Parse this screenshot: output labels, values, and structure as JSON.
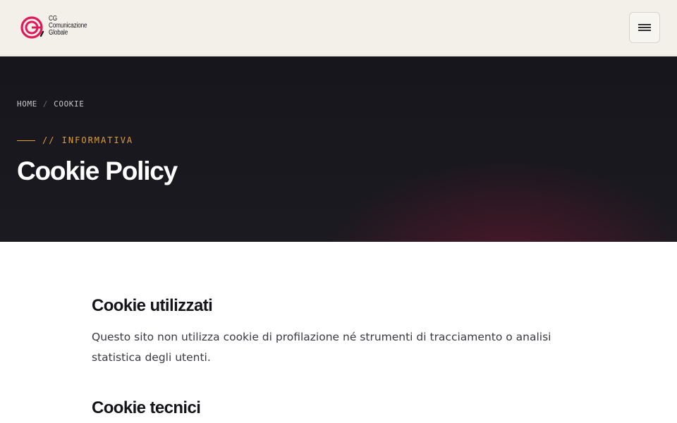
{
  "header": {
    "logo": {
      "line1": "CG",
      "line2": "Comunicazione",
      "line3": "Globale"
    },
    "menu_icon": "hamburger-icon"
  },
  "hero": {
    "breadcrumb": {
      "home": "HOME",
      "separator": "/",
      "current": "COOKIE"
    },
    "eyebrow": "// INFORMATIVA",
    "title": "Cookie Policy"
  },
  "content": {
    "sections": [
      {
        "title": "Cookie utilizzati",
        "body": "Questo sito non utilizza cookie di profilazione né strumenti di tracciamento o analisi statistica degli utenti."
      },
      {
        "title": "Cookie tecnici"
      }
    ]
  },
  "colors": {
    "accent": "#e0a035",
    "brand_magenta": "#e0185c",
    "header_bg": "#f3f0ea",
    "hero_bg": "#16161c"
  }
}
